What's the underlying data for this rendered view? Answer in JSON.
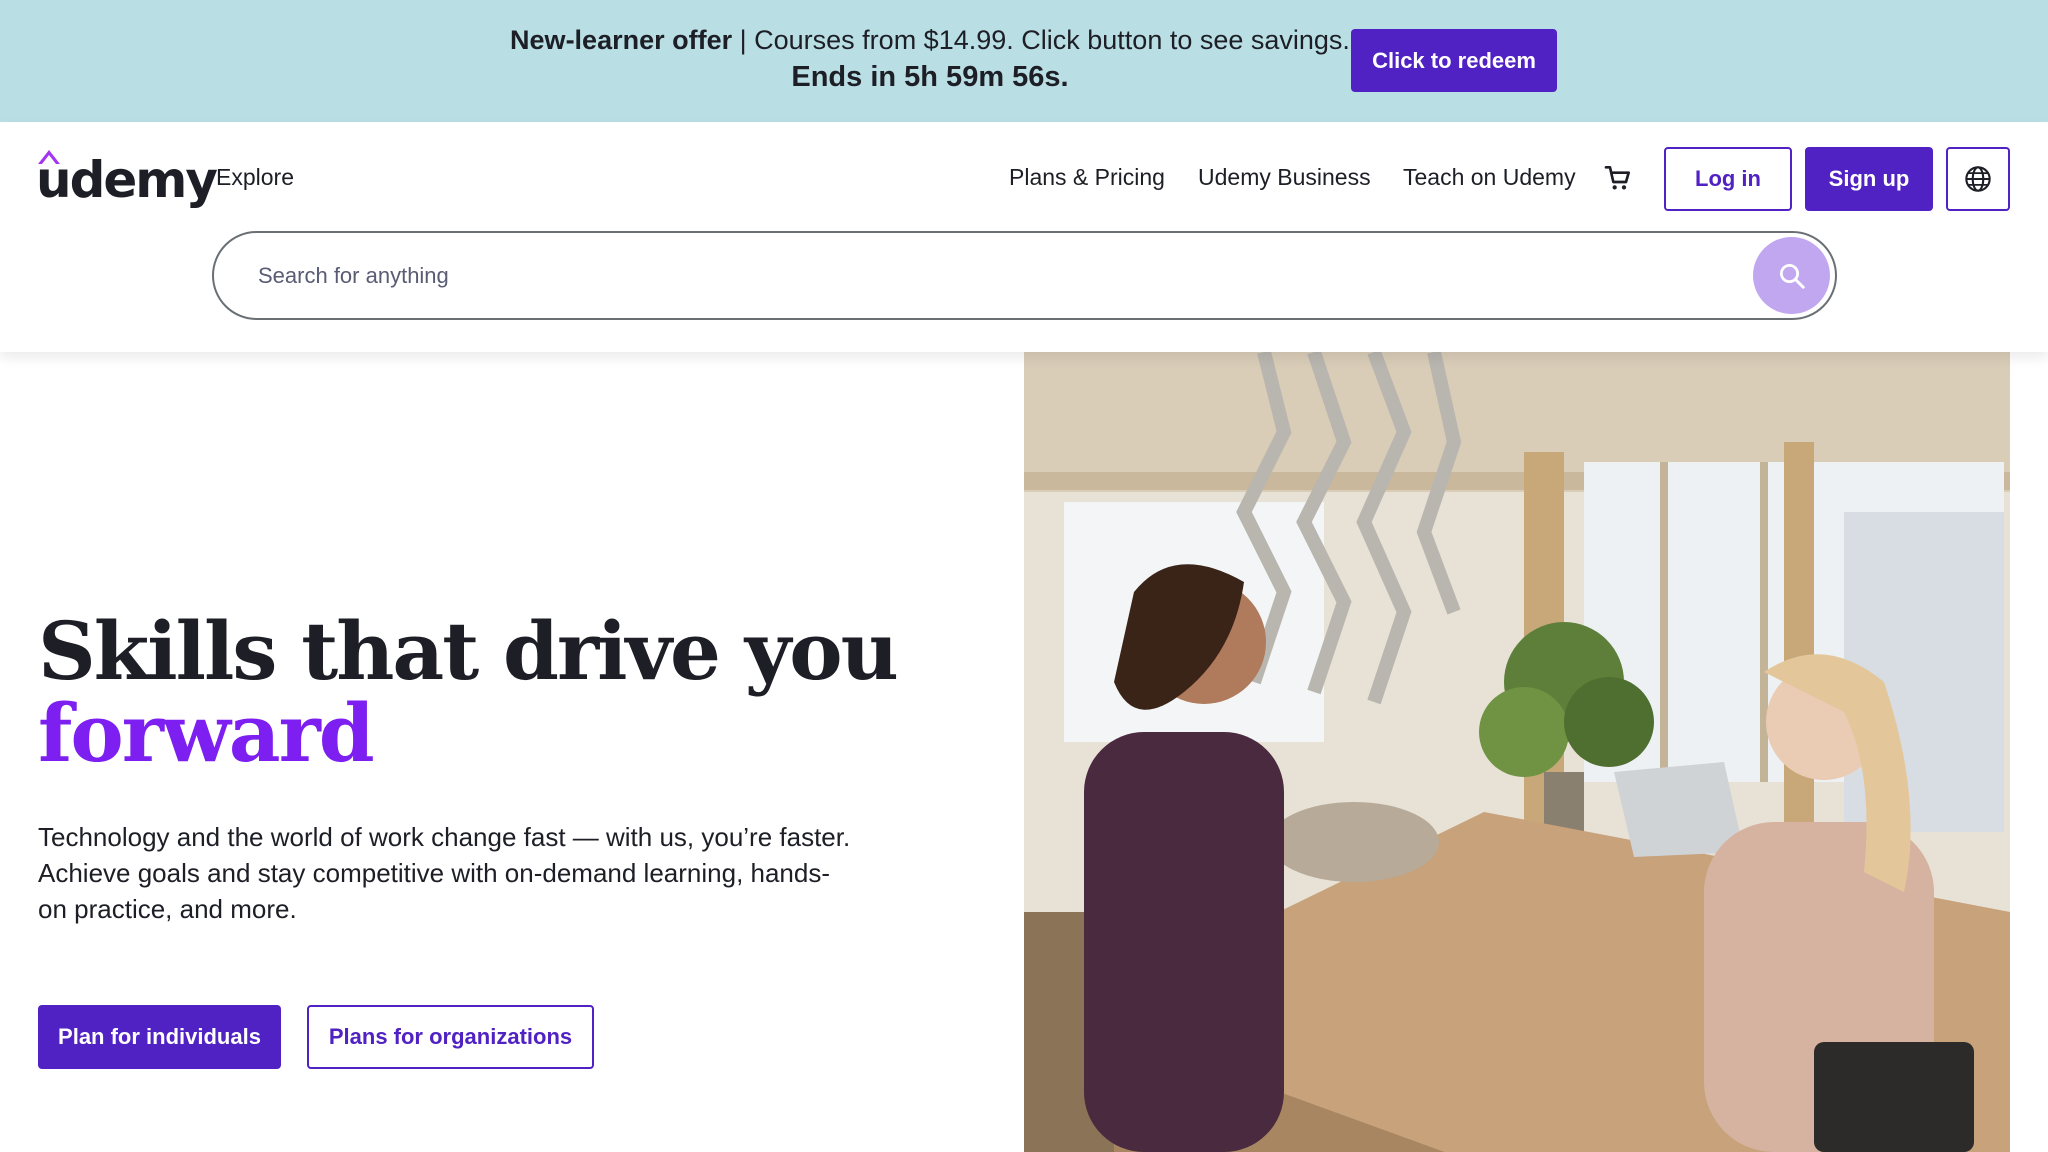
{
  "promo": {
    "bold_label": "New-learner offer",
    "text": " | Courses from $14.99. Click button to see savings.",
    "countdown": "Ends in 5h 59m 56s.",
    "button_label": "Click to redeem"
  },
  "header": {
    "logo_text": "udemy",
    "explore_label": "Explore",
    "nav": {
      "plans": "Plans & Pricing",
      "business": "Udemy Business",
      "teach": "Teach on Udemy"
    },
    "login_label": "Log in",
    "signup_label": "Sign up",
    "icons": {
      "cart": "cart-icon",
      "globe": "globe-icon",
      "search": "search-icon"
    }
  },
  "search": {
    "placeholder": "Search for anything",
    "value": ""
  },
  "hero": {
    "title_line1": "Skills that drive you",
    "title_line2": "forward",
    "subtitle": "Technology and the world of work change fast — with us, you’re faster. Achieve goals and stay competitive with on-demand learning, hands-on practice, and more.",
    "primary_button": "Plan for individuals",
    "secondary_button": "Plans for organizations"
  },
  "colors": {
    "brand": "#5022c3",
    "accent": "#7d1ff0",
    "banner": "#b9dfe5",
    "search_button": "#c0a7f0"
  }
}
